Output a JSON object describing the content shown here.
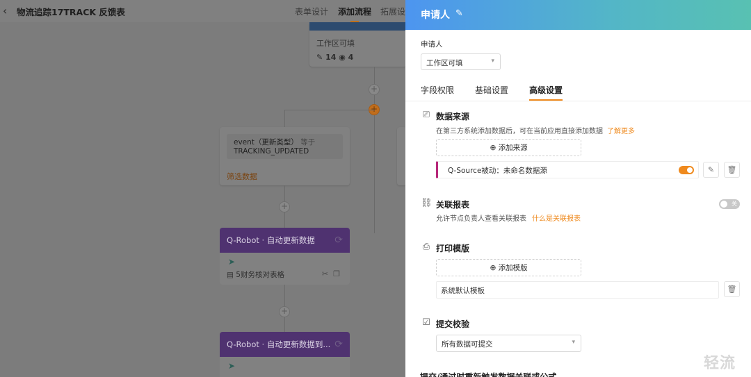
{
  "topbar": {
    "back_icon": "chevron-left-icon",
    "title": "物流追踪17TRACK 反馈表",
    "tabs": [
      {
        "label": "表单设计",
        "active": false
      },
      {
        "label": "添加流程",
        "active": true
      },
      {
        "label": "拓展设",
        "active": false
      }
    ]
  },
  "canvas": {
    "top_card": {
      "label": "工作区可填",
      "edit_count": "14",
      "view_count": "4"
    },
    "filter_card": {
      "condition_field": "event（更新类型）",
      "condition_op": "等于",
      "condition_value": "TRACKING_UPDATED",
      "footer": "筛选数据"
    },
    "robot1": {
      "title": "Q-Robot · 自动更新数据",
      "info": "5财务核对表格"
    },
    "robot2": {
      "title": "Q-Robot · 自动更新数据到..."
    }
  },
  "drawer": {
    "title": "申请人",
    "field_label": "申请人",
    "field_select": "工作区可填",
    "tabs": [
      {
        "label": "字段权限",
        "active": false
      },
      {
        "label": "基础设置",
        "active": false
      },
      {
        "label": "高级设置",
        "active": true
      }
    ],
    "data_source": {
      "title": "数据来源",
      "desc": "在第三方系统添加数据后，可在当前应用直接添加数据",
      "link": "了解更多",
      "add_button": "添加来源",
      "source_item": "Q-Source被动：未命名数据源",
      "toggle_on": true
    },
    "linked_report": {
      "title": "关联报表",
      "desc": "允许节点负责人查看关联报表",
      "link": "什么是关联报表",
      "toggle_label": "关",
      "toggle_on": false
    },
    "print_template": {
      "title": "打印模版",
      "add_button": "添加模版",
      "template_item": "系统默认模板"
    },
    "submit_check": {
      "title": "提交校验",
      "select_value": "所有数据可提交"
    },
    "cutoff_section": {
      "title": "提交/通过时重新触发数据关联或公式"
    }
  },
  "watermark": "轻流",
  "colors": {
    "accent": "#ef8a1e",
    "header_start": "#4d95f0",
    "header_end": "#58c1b2",
    "robot_purple": "#7b4fb8"
  }
}
